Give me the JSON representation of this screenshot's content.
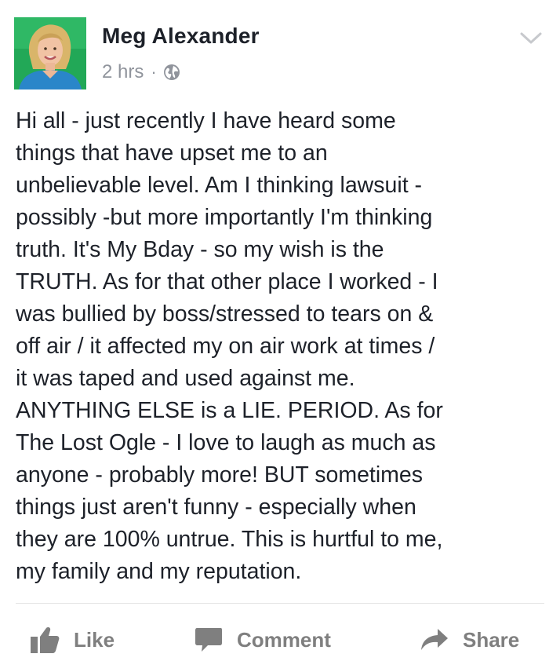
{
  "post": {
    "author": "Meg Alexander",
    "timestamp": "2 hrs",
    "privacy_icon": "globe-icon",
    "options_icon": "chevron-down-icon",
    "lines": [
      "Hi all - just recently I have heard some",
      "things that have upset me to an",
      "unbelievable level. Am I thinking lawsuit -",
      "possibly -but more importantly I'm thinking",
      "truth. It's My Bday - so my wish is the",
      "TRUTH. As for that other place I worked - I",
      "was bullied by boss/stressed to tears on &",
      "off air / it affected my on air work at times /",
      "it was taped and used against me.",
      "ANYTHING ELSE is a LIE. PERIOD. As for",
      "The Lost Ogle - I love to laugh as much as",
      "anyone - probably more! BUT sometimes",
      "things just aren't funny - especially when",
      "they are 100% untrue.  This is hurtful to me,",
      "my family and my reputation."
    ]
  },
  "actions": {
    "like_label": "Like",
    "comment_label": "Comment",
    "share_label": "Share"
  },
  "colors": {
    "text": "#1d2129",
    "meta": "#90949c",
    "action": "#7f7f7f",
    "avatar_bg": "#1fa352"
  }
}
